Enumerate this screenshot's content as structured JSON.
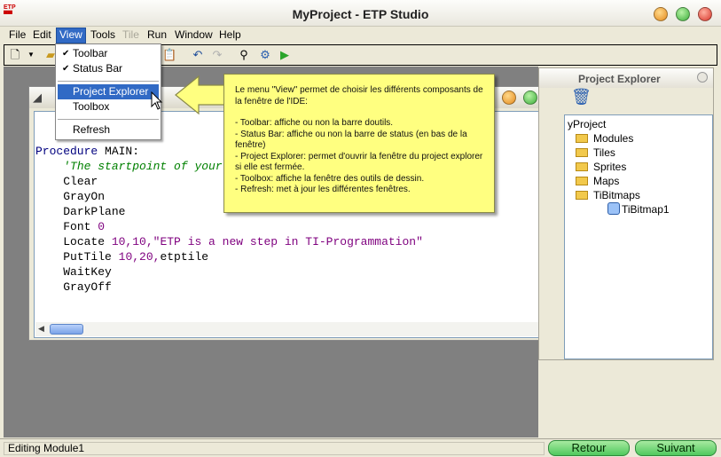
{
  "app": {
    "title": "MyProject - ETP Studio",
    "logo_text": "ETP Studio"
  },
  "menubar": {
    "items": [
      {
        "label": "File",
        "underline": "F"
      },
      {
        "label": "Edit",
        "underline": "E"
      },
      {
        "label": "View",
        "underline": "V"
      },
      {
        "label": "Tools",
        "underline": "T"
      },
      {
        "label": "Tile",
        "underline": ""
      },
      {
        "label": "Run",
        "underline": ""
      },
      {
        "label": "Window",
        "underline": "W"
      },
      {
        "label": "Help",
        "underline": "H"
      }
    ]
  },
  "view_menu": {
    "toolbar": "Toolbar",
    "status_bar": "Status Bar",
    "project_explorer": "Project Explorer",
    "toolbox": "Toolbox",
    "refresh": "Refresh"
  },
  "callout": {
    "intro": "Le menu \"View\" permet de choisir les différents composants de la fenêtre de l'IDE:",
    "lines": [
      "- Toolbar: affiche ou non la barre doutils.",
      "- Status Bar: affiche ou non la barre de status (en bas de la fenêtre)",
      "- Project Explorer: permet d'ouvrir la fenêtre du project explorer si elle est fermée.",
      "- Toolbox: affiche la fenêtre des outils de dessin.",
      "- Refresh: met à jour les différentes fenêtres."
    ]
  },
  "code": {
    "l1_kw": "Procedure",
    "l1_rest": " MAIN:",
    "l2": "'The startpoint of your",
    "l3": "Clear",
    "l4": "GrayOn",
    "l5": "DarkPlane",
    "l6_kw": "Font ",
    "l6_num": "0",
    "l7_kw": "Locate ",
    "l7_num": "10,10,",
    "l7_str": "\"ETP is a new step in TI-Programmation\"",
    "l8_kw": "PutTile ",
    "l8_num": "10,20,",
    "l8_rest": "etptile",
    "l9": "WaitKey",
    "l10": "GrayOff"
  },
  "project_explorer": {
    "title": "Project Explorer",
    "root": "yProject",
    "folders": [
      "Modules",
      "Tiles",
      "Sprites",
      "Maps",
      "TiBitmaps"
    ],
    "child": "TiBitmap1"
  },
  "statusbar": {
    "text": "Editing Module1"
  },
  "nav": {
    "back": "Retour",
    "next": "Suivant"
  },
  "colors": {
    "menu_highlight": "#316ac5",
    "callout_bg": "#ffff80",
    "workspace": "#808080"
  }
}
